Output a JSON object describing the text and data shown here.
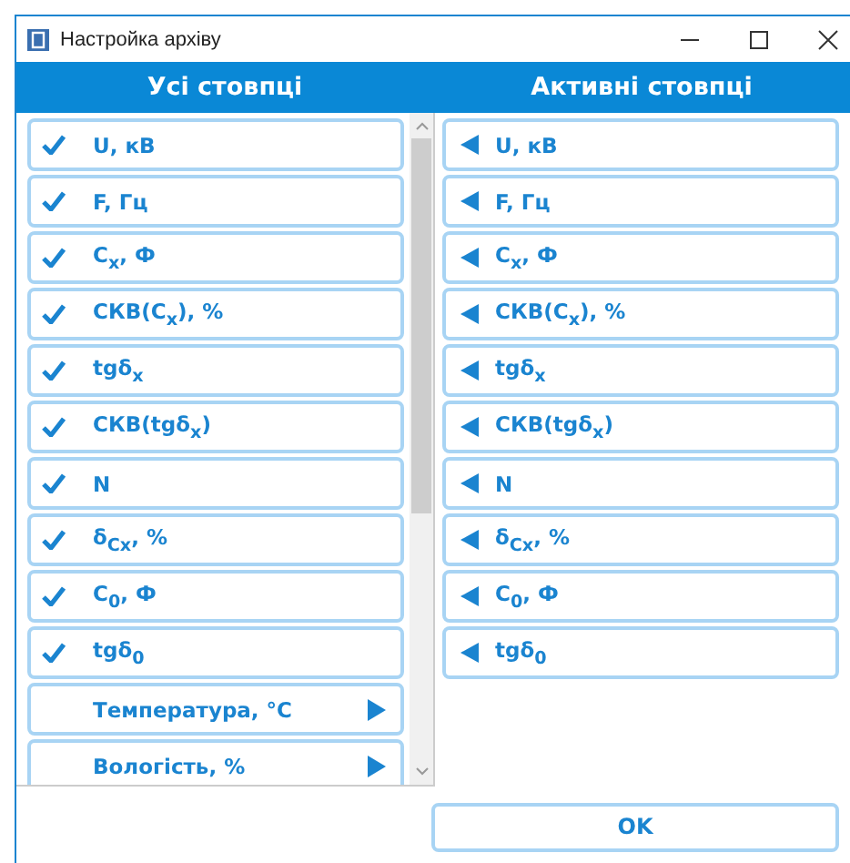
{
  "window": {
    "title": "Настройка архіву"
  },
  "columns": [
    {
      "heading": "Усі стовпці"
    },
    {
      "heading": "Активні стовпці"
    }
  ],
  "all_columns": [
    {
      "label": "U, кВ",
      "checked": true,
      "kind": "item"
    },
    {
      "label": "F, Гц",
      "checked": true,
      "kind": "item"
    },
    {
      "label": "C$_{x}$, Ф",
      "checked": true,
      "kind": "item"
    },
    {
      "label": "СКВ(C$_{x}$), %",
      "checked": true,
      "kind": "item"
    },
    {
      "label": "tgδ$_{x}$",
      "checked": true,
      "kind": "item"
    },
    {
      "label": "СКВ(tgδ$_{x}$)",
      "checked": true,
      "kind": "item"
    },
    {
      "label": "N",
      "checked": true,
      "kind": "item"
    },
    {
      "label": "δ$_{Cx}$, %",
      "checked": true,
      "kind": "item"
    },
    {
      "label": "C$_{0}$, Ф",
      "checked": true,
      "kind": "item"
    },
    {
      "label": "tgδ$_{0}$",
      "checked": true,
      "kind": "item"
    },
    {
      "label": "Температура, °C",
      "checked": false,
      "kind": "submenu"
    },
    {
      "label": "Вологість, %",
      "checked": false,
      "kind": "submenu"
    }
  ],
  "active_columns": [
    {
      "label": "U, кВ"
    },
    {
      "label": "F, Гц"
    },
    {
      "label": "C$_{x}$, Ф"
    },
    {
      "label": "СКВ(C$_{x}$), %"
    },
    {
      "label": "tgδ$_{x}$"
    },
    {
      "label": "СКВ(tgδ$_{x}$)"
    },
    {
      "label": "N"
    },
    {
      "label": "δ$_{Cx}$, %"
    },
    {
      "label": "C$_{0}$, Ф"
    },
    {
      "label": "tgδ$_{0}$"
    }
  ],
  "buttons": [
    {
      "label": "OK"
    }
  ]
}
